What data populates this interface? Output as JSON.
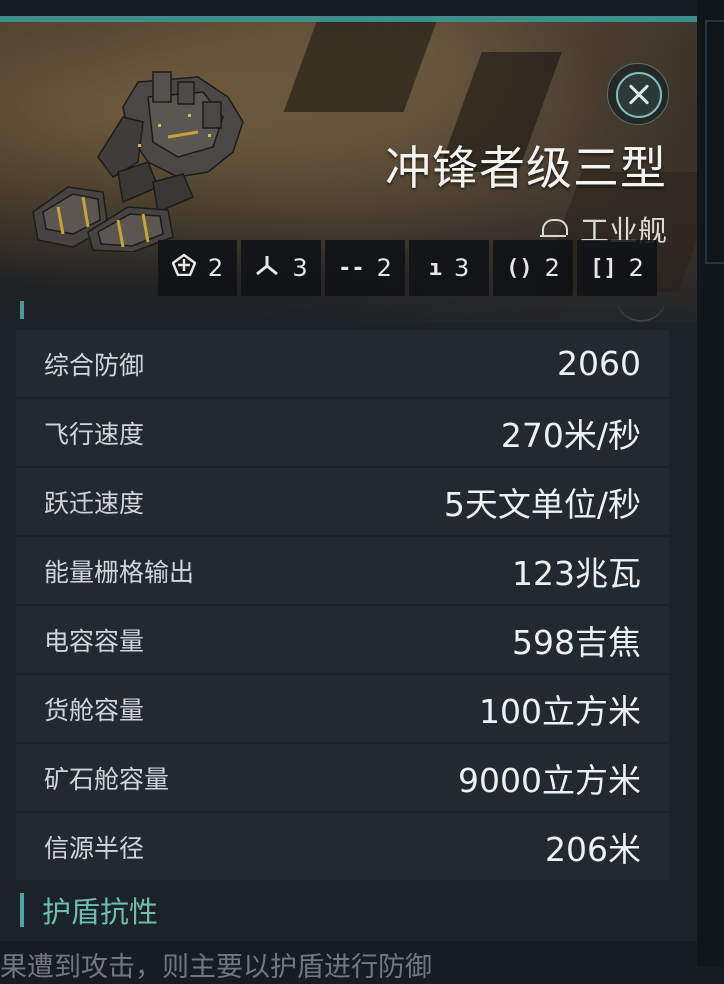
{
  "ship": {
    "name": "冲锋者级三型",
    "class_label": "工业舰"
  },
  "slots": [
    {
      "icon": "drone-bay-icon",
      "glyph": "⟰",
      "count": "2"
    },
    {
      "icon": "turret-icon",
      "glyph": "⅄",
      "count": "3"
    },
    {
      "icon": "high-slot-icon",
      "glyph": "--",
      "count": "2"
    },
    {
      "icon": "mid-slot-icon",
      "glyph": "ı",
      "count": "3"
    },
    {
      "icon": "low-slot-icon",
      "glyph": "()",
      "count": "2"
    },
    {
      "icon": "rig-slot-icon",
      "glyph": "[]",
      "count": "2"
    }
  ],
  "stats": [
    {
      "label": "综合防御",
      "value": "2060"
    },
    {
      "label": "飞行速度",
      "value": "270米/秒"
    },
    {
      "label": "跃迁速度",
      "value": "5天文单位/秒"
    },
    {
      "label": "能量栅格输出",
      "value": "123兆瓦"
    },
    {
      "label": "电容容量",
      "value": "598吉焦"
    },
    {
      "label": "货舱容量",
      "value": "100立方米"
    },
    {
      "label": "矿石舱容量",
      "value": "9000立方米"
    },
    {
      "label": "信源半径",
      "value": "206米"
    }
  ],
  "sections": {
    "shield_resistance_title": "护盾抗性"
  },
  "footer_text": "果遭到攻击，则主要以护盾进行防御",
  "colors": {
    "accent": "#3e8d8a",
    "section_title": "#6fbdb2",
    "row_bg": "#222a31",
    "panel_bg": "#1b2228"
  }
}
